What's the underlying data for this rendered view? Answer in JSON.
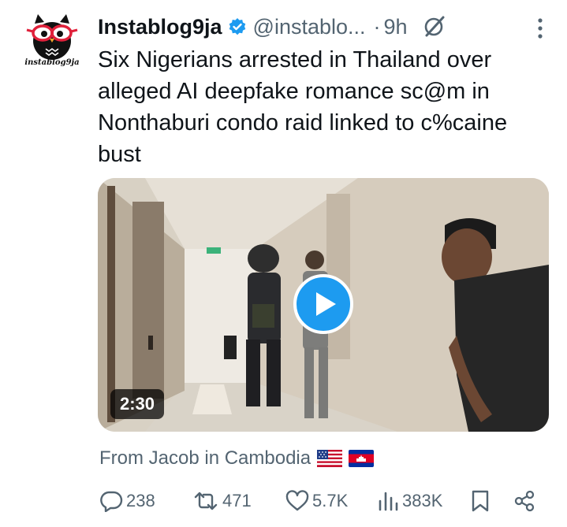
{
  "post": {
    "author_name": "Instablog9ja",
    "handle": "@instablo...",
    "separator": "·",
    "time": "9h",
    "avatar_label": "instablog9ja",
    "text": "Six Nigerians arrested in Thailand over alleged AI deepfake romance sc@m in Nonthaburi condo raid linked to c%caine bust",
    "media": {
      "duration": "2:30"
    },
    "media_caption": "From Jacob in Cambodia",
    "flags": [
      "us-flag",
      "cambodia-flag"
    ]
  },
  "actions": {
    "replies": "238",
    "reposts": "471",
    "likes": "5.7K",
    "views": "383K"
  },
  "colors": {
    "accent": "#1d9bf0",
    "muted_text": "#536471",
    "text": "#0f1419"
  }
}
